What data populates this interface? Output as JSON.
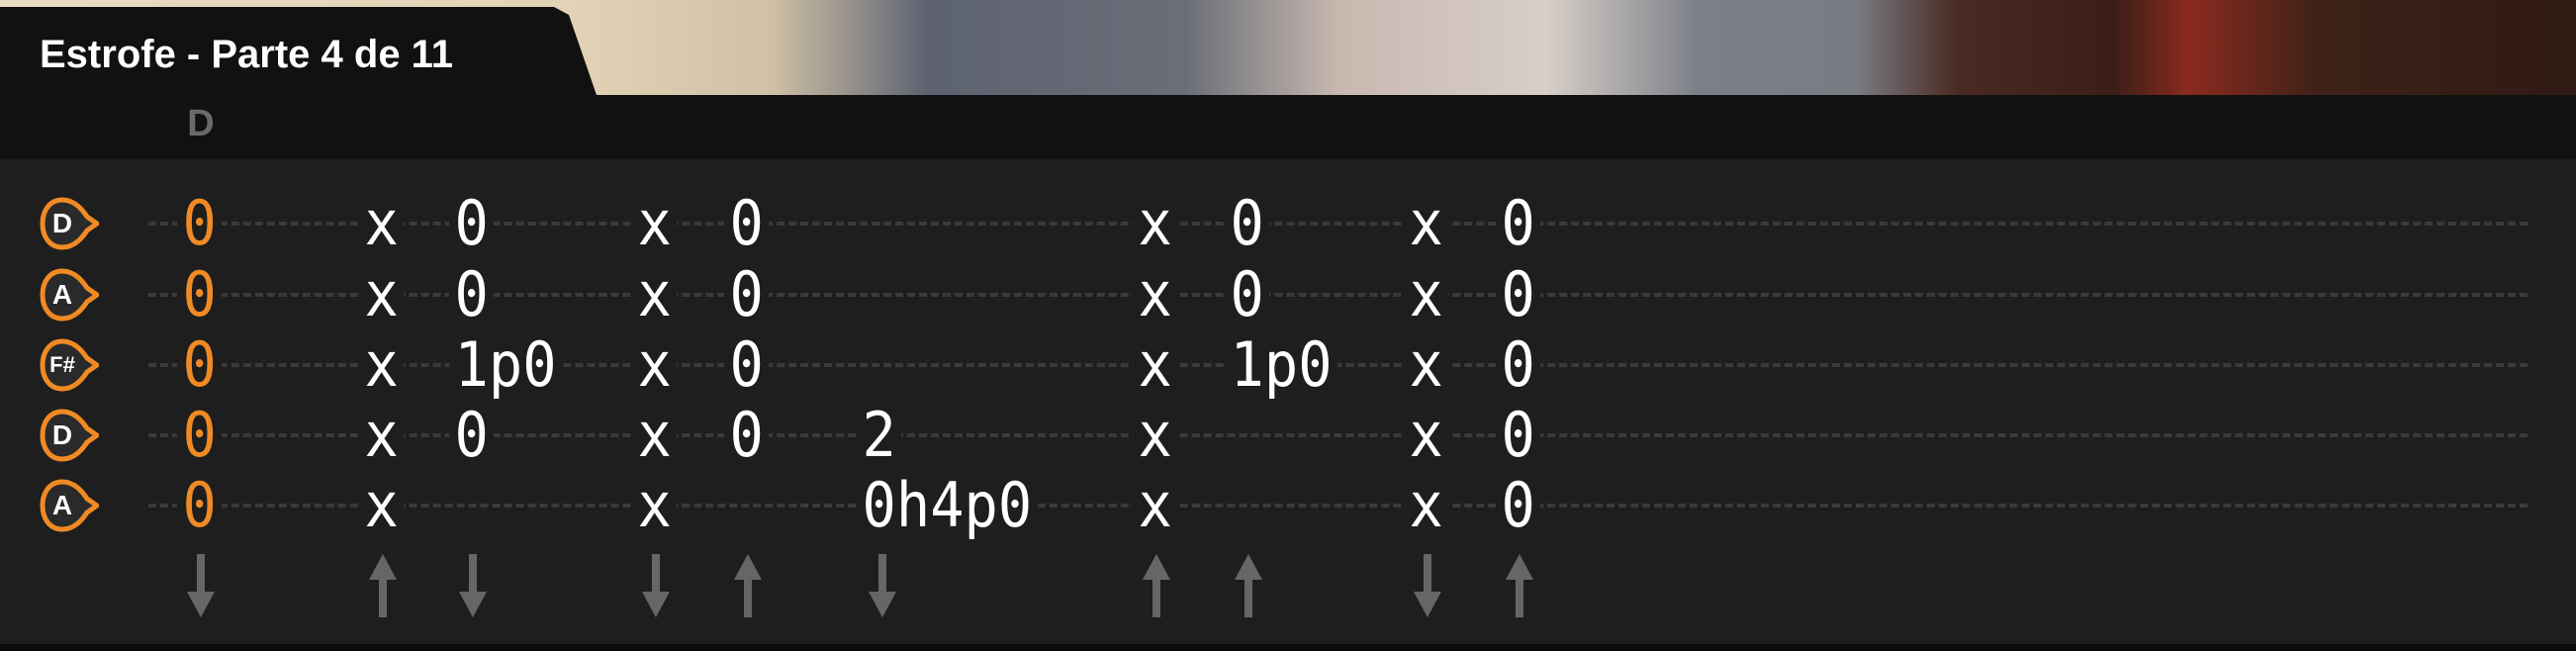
{
  "header": {
    "title": "Estrofe - Parte 4 de 11"
  },
  "chords": [
    "D"
  ],
  "strings": [
    "D",
    "A",
    "F#",
    "D",
    "A"
  ],
  "colors": {
    "accent": "#f08a24",
    "note": "#ffffff",
    "arrow": "#666666",
    "chord": "#6a6a6a"
  },
  "columns": [
    {
      "notes": [
        "0",
        "0",
        "0",
        "0",
        "0"
      ],
      "strum": "down",
      "highlight": true
    },
    {
      "notes": [
        "x",
        "x",
        "x",
        "x",
        "x"
      ],
      "strum": "up"
    },
    {
      "notes": [
        "0",
        "0",
        "1p0",
        "0",
        ""
      ],
      "strum": "down"
    },
    {
      "notes": [
        "x",
        "x",
        "x",
        "x",
        "x"
      ],
      "strum": "down"
    },
    {
      "notes": [
        "0",
        "0",
        "0",
        "0",
        ""
      ],
      "strum": "up"
    },
    {
      "notes": [
        "",
        "",
        "",
        "2",
        "0h4p0"
      ],
      "strum": "down"
    },
    {
      "notes": [
        "x",
        "x",
        "x",
        "x",
        "x"
      ],
      "strum": "up"
    },
    {
      "notes": [
        "0",
        "0",
        "1p0",
        "",
        ""
      ],
      "strum": "up"
    },
    {
      "notes": [
        "x",
        "x",
        "x",
        "x",
        "x"
      ],
      "strum": "down"
    },
    {
      "notes": [
        "0",
        "0",
        "0",
        "0",
        "0"
      ],
      "strum": "up"
    }
  ]
}
